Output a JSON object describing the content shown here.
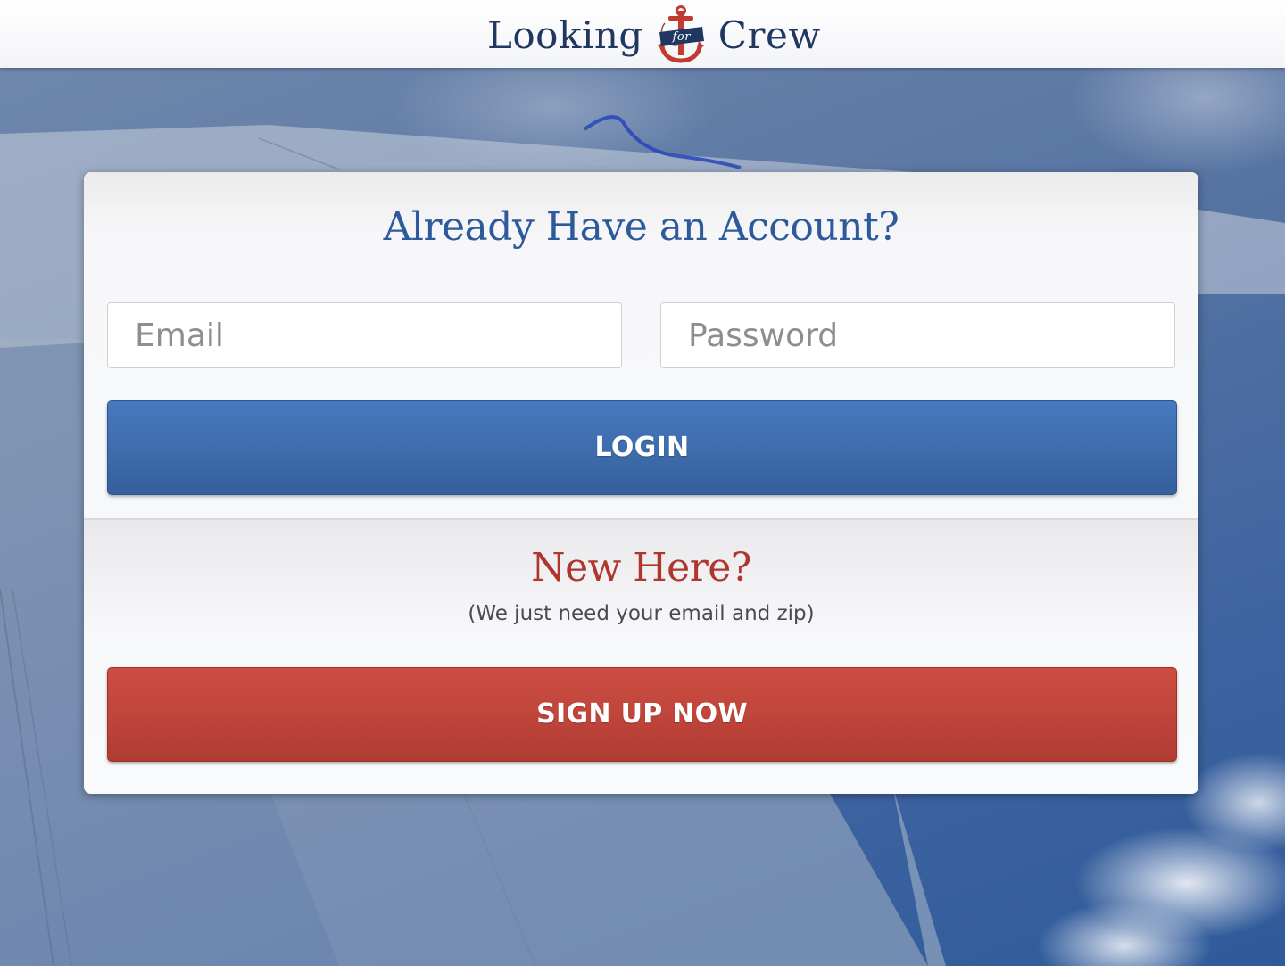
{
  "header": {
    "logo": {
      "word_left": "Looking",
      "word_middle": "for",
      "word_right": "Crew"
    }
  },
  "login": {
    "heading": "Already Have an Account?",
    "email_placeholder": "Email",
    "password_placeholder": "Password",
    "button_label": "LOGIN"
  },
  "signup": {
    "heading": "New Here?",
    "subtext": "(We just need your email and zip)",
    "button_label": "SIGN UP NOW"
  },
  "colors": {
    "brand_navy": "#1f3761",
    "login_blue": "#3e6dad",
    "signup_red": "#c0453b",
    "heading_blue": "#2d5a9a",
    "heading_red": "#b0352c"
  },
  "icons": {
    "logo_emblem": "anchor-icon"
  }
}
